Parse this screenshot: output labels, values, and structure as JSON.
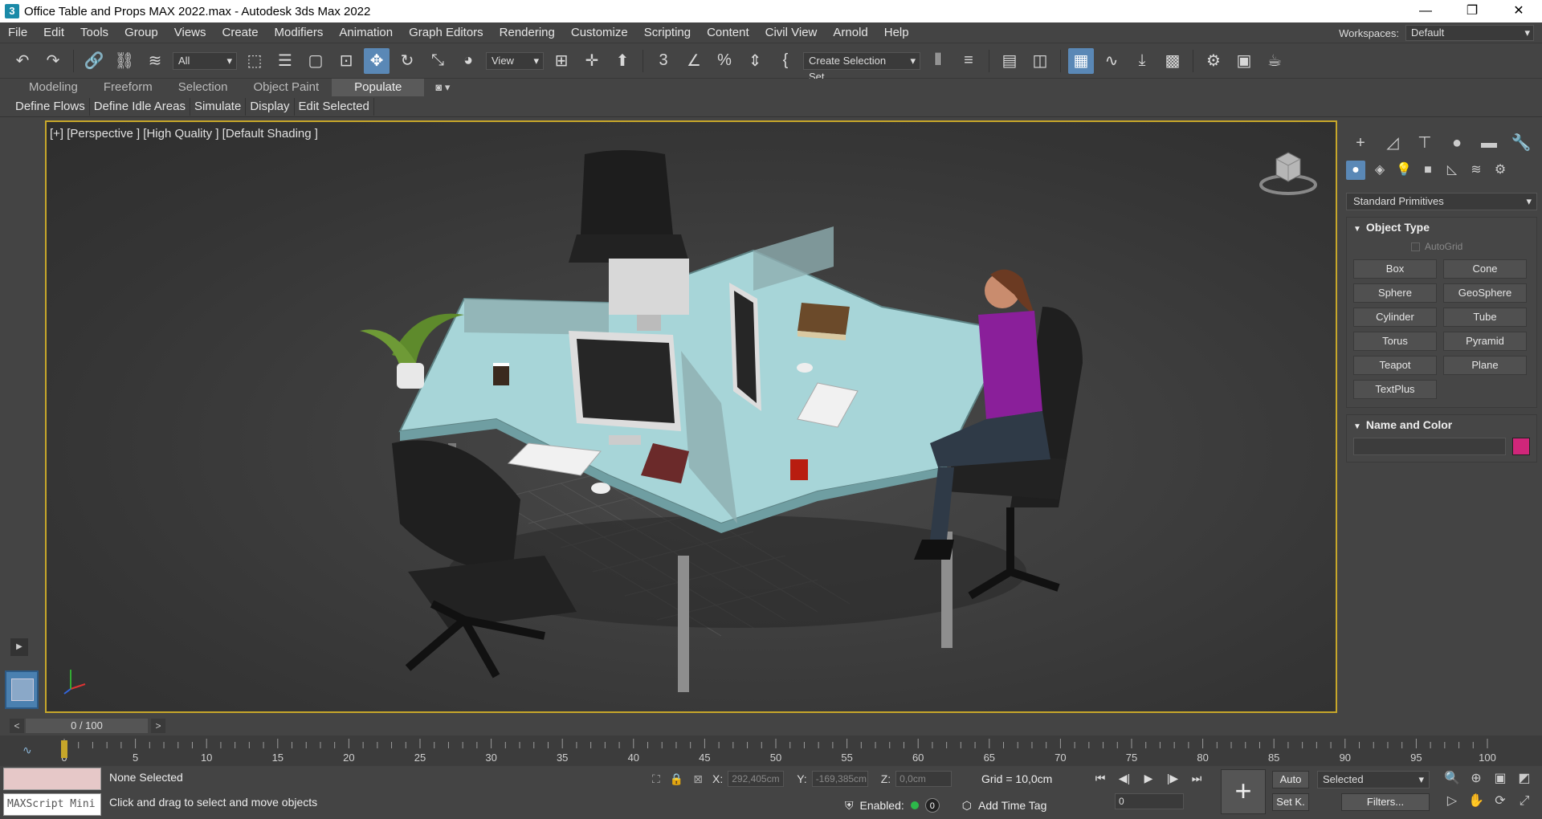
{
  "window": {
    "app_icon": "3",
    "title": "Office Table and Props MAX 2022.max - Autodesk 3ds Max 2022",
    "controls": [
      "—",
      "❐",
      "✕"
    ]
  },
  "menubar": {
    "items": [
      "File",
      "Edit",
      "Tools",
      "Group",
      "Views",
      "Create",
      "Modifiers",
      "Animation",
      "Graph Editors",
      "Rendering",
      "Customize",
      "Scripting",
      "Content",
      "Civil View",
      "Arnold",
      "Help"
    ],
    "workspaces_label": "Workspaces:",
    "workspaces_value": "Default"
  },
  "toolbar": {
    "selection_filter": "All",
    "ref_coord": "View",
    "selection_set": "Create Selection Set"
  },
  "ribbon": {
    "tabs": [
      "Modeling",
      "Freeform",
      "Selection",
      "Object Paint",
      "Populate"
    ],
    "active_tab": "Populate",
    "subtabs": [
      "Define Flows",
      "Define Idle Areas",
      "Simulate",
      "Display",
      "Edit Selected"
    ]
  },
  "viewport": {
    "label": "[+] [Perspective ] [High Quality ] [Default Shading ]"
  },
  "command_panel": {
    "category": "Standard Primitives",
    "object_type_title": "Object Type",
    "autogrid_label": "AutoGrid",
    "buttons": [
      "Box",
      "Cone",
      "Sphere",
      "GeoSphere",
      "Cylinder",
      "Tube",
      "Torus",
      "Pyramid",
      "Teapot",
      "Plane",
      "TextPlus"
    ],
    "name_color_title": "Name and Color",
    "object_color": "#d0267a"
  },
  "timeline": {
    "frame_display": "0 / 100",
    "prev": "<",
    "next": ">",
    "ticks": [
      "0",
      "5",
      "10",
      "15",
      "20",
      "25",
      "30",
      "35",
      "40",
      "45",
      "50",
      "55",
      "60",
      "65",
      "70",
      "75",
      "80",
      "85",
      "90",
      "95",
      "100"
    ]
  },
  "status": {
    "maxscript_label": "MAXScript Mini",
    "selection": "None Selected",
    "prompt": "Click and drag to select and move objects",
    "x_label": "X:",
    "x_value": "292,405cm",
    "y_label": "Y:",
    "y_value": "-169,385cm",
    "z_label": "Z:",
    "z_value": "0,0cm",
    "grid": "Grid = 10,0cm",
    "enabled_label": "Enabled:",
    "enabled_count": "0",
    "add_time_tag": "Add Time Tag",
    "current_frame": "0",
    "auto": "Auto",
    "set_key": "Set K.",
    "key_filter": "Selected",
    "filters": "Filters..."
  }
}
